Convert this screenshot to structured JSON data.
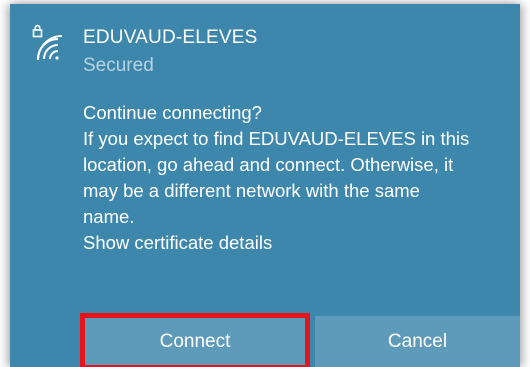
{
  "network": {
    "name": "EDUVAUD-ELEVES",
    "status": "Secured",
    "icon": "wifi-secured-icon"
  },
  "message": {
    "line1": "Continue connecting?",
    "line2": "If you expect to find EDUVAUD-ELEVES in this",
    "line3": "location, go ahead and connect. Otherwise, it",
    "line4": "may be a different network with the same",
    "line5": "name.",
    "link": "Show certificate details"
  },
  "buttons": {
    "connect_label": "Connect",
    "cancel_label": "Cancel"
  },
  "colors": {
    "panel_background": "#3d87ad",
    "button_background": "#5e9bbb",
    "highlight": "#e4161b",
    "secondary_text": "#b8d3e2"
  }
}
